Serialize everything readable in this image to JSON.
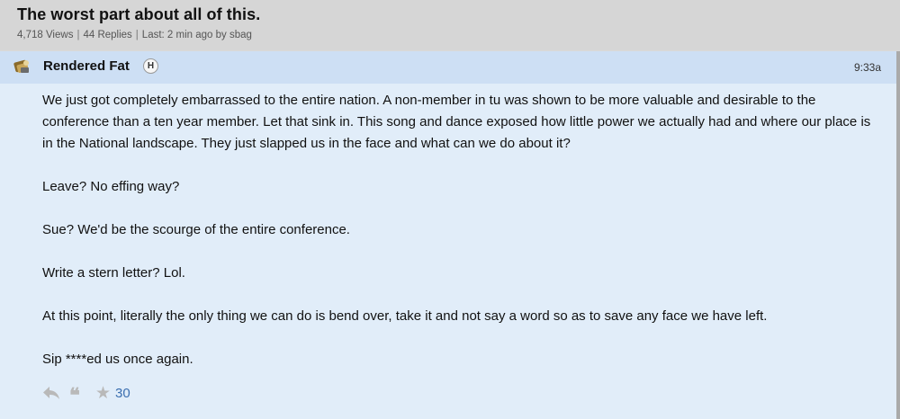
{
  "thread": {
    "title": "The worst part about all of this.",
    "views": "4,718 Views",
    "replies": "44 Replies",
    "last": "Last: 2 min ago by sbag"
  },
  "post": {
    "username": "Rendered Fat",
    "badge": "H",
    "time": "9:33a",
    "paragraphs": [
      "We just got completely embarrassed to the entire nation. A non-member in tu was shown to be more valuable and desirable to the conference than a ten year member. Let that sink in. This song and dance exposed how little power we actually had and where our place is in the National landscape. They just slapped us in the face and what can we do about it?",
      "Leave? No effing way?",
      "Sue? We'd be the scourge of the entire conference.",
      "Write a stern letter? Lol.",
      "At this point, literally the only thing we can do is bend over, take it and not say a word so as to save any face we have left.",
      "Sip ****ed us once again."
    ],
    "star_count": "30",
    "icons": {
      "reply": "reply-icon",
      "quote": "quote-icon",
      "star": "star-icon",
      "avatar": "avatar-icon"
    }
  },
  "colors": {
    "header_bg": "#d6d6d6",
    "post_bg": "#e1edf9",
    "post_head_bg": "#cddff4",
    "link": "#3b6fb0"
  }
}
